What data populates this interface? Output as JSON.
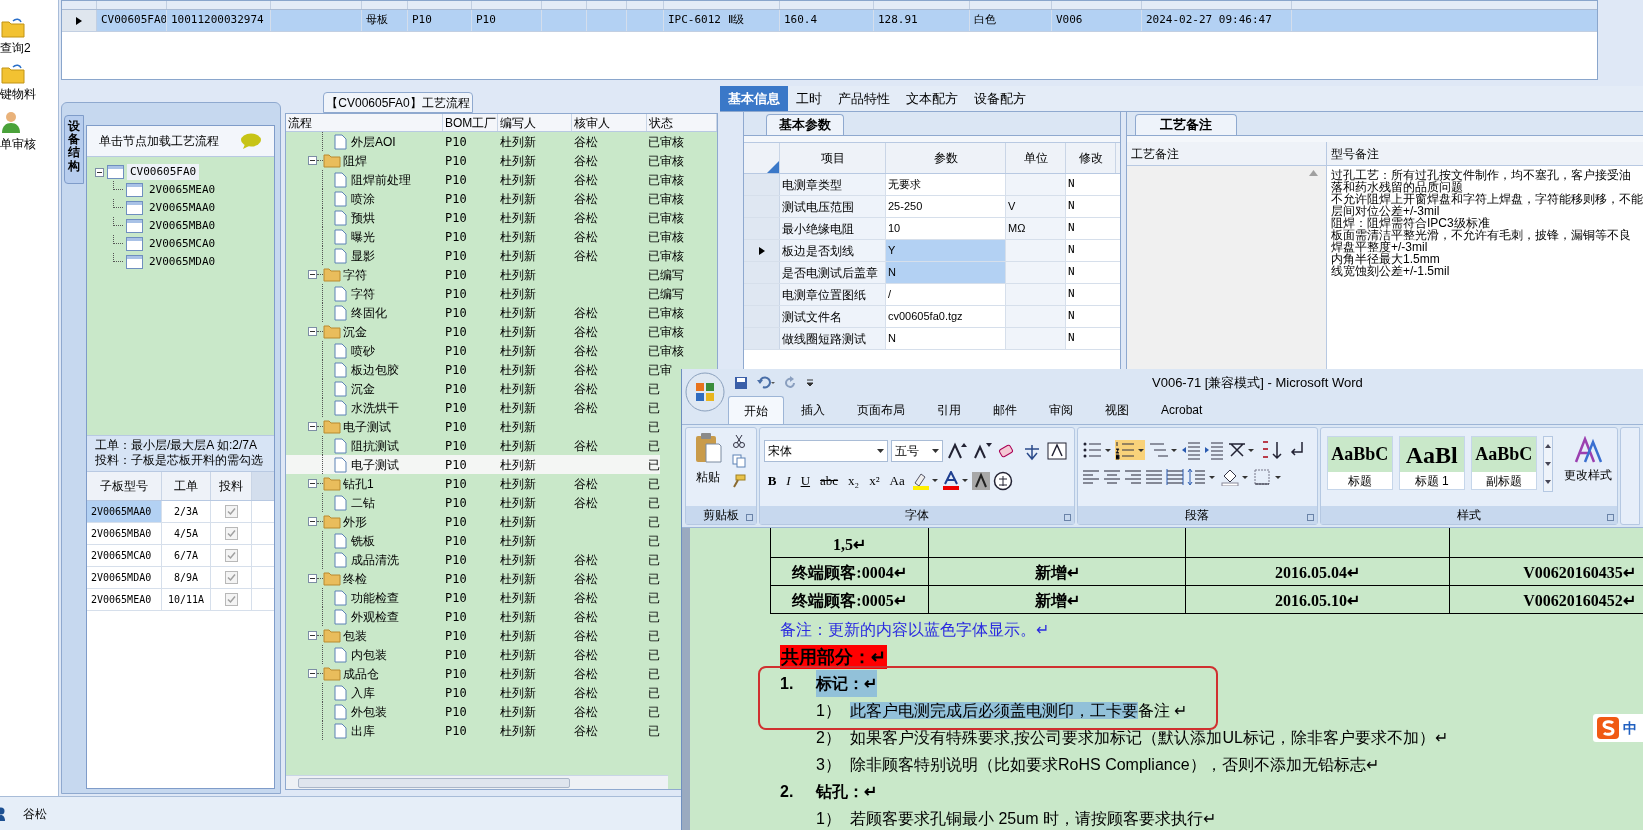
{
  "sidebar": {
    "items": [
      {
        "label": "查询2",
        "kind": "folder"
      },
      {
        "label": "键物料",
        "kind": "folder"
      },
      {
        "label": "单审核",
        "kind": "person"
      }
    ]
  },
  "top_grid": {
    "rows": [
      {
        "selected": true,
        "column_1": "CV00605FA0",
        "column_2": "10011200032974",
        "column_4": "母板",
        "column_5": "P10",
        "column_6": "P10",
        "column_10": "IPC-6012 Ⅱ级",
        "column_11": "160.4",
        "column_12": "128.91",
        "column_13": "白色",
        "column_14": "V006",
        "column_15": "2024-02-27 09:46:47"
      }
    ]
  },
  "structure_panel": {
    "tab": "设备结构",
    "hint": "单击节点加载工艺流程",
    "tree": {
      "label": "CV00605FA0",
      "expanded": true,
      "selected": true,
      "children": [
        {
          "label": "2V0065MEA0",
          "selected": false
        },
        {
          "label": "2V0065MAA0",
          "selected": false
        },
        {
          "label": "2V0065MBA0",
          "selected": false
        },
        {
          "label": "2V0065MCA0",
          "selected": false
        },
        {
          "label": "2V0065MDA0",
          "selected": false
        }
      ]
    },
    "notes": [
      "工单：最小层/最大层A 如:2/7A",
      "投料：子板是芯板开料的需勾选"
    ],
    "table": {
      "columns": [
        "子板型号",
        "工单",
        "投料"
      ],
      "rows": [
        {
          "model": "2V0065MAA0",
          "order": "2/3A",
          "feed": true,
          "selected": true
        },
        {
          "model": "2V0065MBA0",
          "order": "4/5A",
          "feed": true,
          "selected": false
        },
        {
          "model": "2V0065MCA0",
          "order": "6/7A",
          "feed": true,
          "selected": false
        },
        {
          "model": "2V0065MDA0",
          "order": "8/9A",
          "feed": true,
          "selected": false
        },
        {
          "model": "2V0065MEA0",
          "order": "10/11A",
          "feed": true,
          "selected": false
        }
      ]
    }
  },
  "flow_panel": {
    "title": "【CV00605FA0】工艺流程",
    "columns": [
      "流程",
      "BOM工厂",
      "编写人",
      "核审人",
      "状态"
    ],
    "items": [
      {
        "kind": "step",
        "label": "外层AOI",
        "bom": "P10",
        "writer": "杜列新",
        "reviewer": "谷松",
        "status": "已审核",
        "selected": false
      },
      {
        "kind": "group",
        "label": "阻焊",
        "bom": "P10",
        "writer": "杜列新",
        "reviewer": "谷松",
        "status": "已审核",
        "selected": false,
        "expanded": true,
        "children": [
          {
            "kind": "step",
            "label": "阻焊前处理",
            "bom": "P10",
            "writer": "杜列新",
            "reviewer": "谷松",
            "status": "已审核",
            "selected": false
          },
          {
            "kind": "step",
            "label": "喷涂",
            "bom": "P10",
            "writer": "杜列新",
            "reviewer": "谷松",
            "status": "已审核",
            "selected": false
          },
          {
            "kind": "step",
            "label": "预烘",
            "bom": "P10",
            "writer": "杜列新",
            "reviewer": "谷松",
            "status": "已审核",
            "selected": false
          },
          {
            "kind": "step",
            "label": "曝光",
            "bom": "P10",
            "writer": "杜列新",
            "reviewer": "谷松",
            "status": "已审核",
            "selected": false
          },
          {
            "kind": "step",
            "label": "显影",
            "bom": "P10",
            "writer": "杜列新",
            "reviewer": "谷松",
            "status": "已审核",
            "selected": false
          }
        ]
      },
      {
        "kind": "group",
        "label": "字符",
        "bom": "P10",
        "writer": "杜列新",
        "status": "已编写",
        "selected": false,
        "expanded": true,
        "children": [
          {
            "kind": "step",
            "label": "字符",
            "bom": "P10",
            "writer": "杜列新",
            "status": "已编写",
            "selected": false
          },
          {
            "kind": "step",
            "label": "终固化",
            "bom": "P10",
            "writer": "杜列新",
            "reviewer": "谷松",
            "status": "已审核",
            "selected": false
          }
        ]
      },
      {
        "kind": "group",
        "label": "沉金",
        "bom": "P10",
        "writer": "杜列新",
        "reviewer": "谷松",
        "status": "已审核",
        "selected": false,
        "expanded": true,
        "children": [
          {
            "kind": "step",
            "label": "喷砂",
            "bom": "P10",
            "writer": "杜列新",
            "reviewer": "谷松",
            "status": "已审核",
            "selected": false
          },
          {
            "kind": "step",
            "label": "板边包胶",
            "bom": "P10",
            "writer": "杜列新",
            "reviewer": "谷松",
            "status": "已审",
            "selected": false
          },
          {
            "kind": "step",
            "label": "沉金",
            "bom": "P10",
            "writer": "杜列新",
            "reviewer": "谷松",
            "status": "已",
            "selected": false
          },
          {
            "kind": "step",
            "label": "水洗烘干",
            "bom": "P10",
            "writer": "杜列新",
            "reviewer": "谷松",
            "status": "已",
            "selected": false
          }
        ]
      },
      {
        "kind": "group",
        "label": "电子测试",
        "bom": "P10",
        "writer": "杜列新",
        "status": "已",
        "selected": false,
        "expanded": true,
        "children": [
          {
            "kind": "step",
            "label": "阻抗测试",
            "bom": "P10",
            "writer": "杜列新",
            "reviewer": "谷松",
            "status": "已",
            "selected": false
          },
          {
            "kind": "step",
            "label": "电子测试",
            "bom": "P10",
            "writer": "杜列新",
            "status": "已",
            "selected": true
          }
        ]
      },
      {
        "kind": "group",
        "label": "钻孔1",
        "bom": "P10",
        "writer": "杜列新",
        "reviewer": "谷松",
        "status": "已",
        "selected": false,
        "expanded": true,
        "children": [
          {
            "kind": "step",
            "label": "二钻",
            "bom": "P10",
            "writer": "杜列新",
            "reviewer": "谷松",
            "status": "已",
            "selected": false
          }
        ]
      },
      {
        "kind": "group",
        "label": "外形",
        "bom": "P10",
        "writer": "杜列新",
        "status": "已",
        "selected": false,
        "expanded": true,
        "children": [
          {
            "kind": "step",
            "label": "铣板",
            "bom": "P10",
            "writer": "杜列新",
            "status": "已",
            "selected": false
          },
          {
            "kind": "step",
            "label": "成品清洗",
            "bom": "P10",
            "writer": "杜列新",
            "reviewer": "谷松",
            "status": "已",
            "selected": false
          }
        ]
      },
      {
        "kind": "group",
        "label": "终检",
        "bom": "P10",
        "writer": "杜列新",
        "reviewer": "谷松",
        "status": "已",
        "selected": false,
        "expanded": true,
        "children": [
          {
            "kind": "step",
            "label": "功能检查",
            "bom": "P10",
            "writer": "杜列新",
            "reviewer": "谷松",
            "status": "已",
            "selected": false
          },
          {
            "kind": "step",
            "label": "外观检查",
            "bom": "P10",
            "writer": "杜列新",
            "reviewer": "谷松",
            "status": "已",
            "selected": false
          }
        ]
      },
      {
        "kind": "group",
        "label": "包装",
        "bom": "P10",
        "writer": "杜列新",
        "reviewer": "谷松",
        "status": "已",
        "selected": false,
        "expanded": true,
        "children": [
          {
            "kind": "step",
            "label": "内包装",
            "bom": "P10",
            "writer": "杜列新",
            "reviewer": "谷松",
            "status": "已",
            "selected": false
          }
        ]
      },
      {
        "kind": "group",
        "label": "成品仓",
        "bom": "P10",
        "writer": "杜列新",
        "reviewer": "谷松",
        "status": "已",
        "selected": false,
        "expanded": true,
        "children": [
          {
            "kind": "step",
            "label": "入库",
            "bom": "P10",
            "writer": "杜列新",
            "reviewer": "谷松",
            "status": "已",
            "selected": false
          },
          {
            "kind": "step",
            "label": "外包装",
            "bom": "P10",
            "writer": "杜列新",
            "reviewer": "谷松",
            "status": "已",
            "selected": false
          },
          {
            "kind": "step",
            "label": "出库",
            "bom": "P10",
            "writer": "杜列新",
            "reviewer": "谷松",
            "status": "已",
            "selected": false
          }
        ]
      }
    ]
  },
  "detail_panel": {
    "tabs": [
      {
        "label": "基本信息",
        "selected": true
      },
      {
        "label": "工时",
        "selected": false
      },
      {
        "label": "产品特性",
        "selected": false
      },
      {
        "label": "文本配方",
        "selected": false
      },
      {
        "label": "设备配方",
        "selected": false
      }
    ],
    "params": {
      "tab": "基本参数",
      "columns": [
        "项目",
        "参数",
        "单位",
        "修改"
      ],
      "rows": [
        {
          "item": "电测章类型",
          "value": "无要求",
          "modified": "N",
          "selected": false,
          "current": false
        },
        {
          "item": "测试电压范围",
          "value": "25-250",
          "unit": "V",
          "modified": "N",
          "selected": false,
          "current": false
        },
        {
          "item": "最小绝缘电阻",
          "value": "10",
          "unit": "MΩ",
          "modified": "N",
          "selected": false,
          "current": false
        },
        {
          "item": "板边是否划线",
          "value": "Y",
          "modified": "N",
          "selected": true,
          "current": true
        },
        {
          "item": "是否电测试后盖章",
          "value": "N",
          "modified": "N",
          "selected": true,
          "current": false
        },
        {
          "item": "电测章位置图纸",
          "value": "/",
          "modified": "N",
          "selected": false,
          "current": false
        },
        {
          "item": "测试文件名",
          "value": "cv00605fa0.tgz",
          "modified": "N",
          "selected": false,
          "current": false
        },
        {
          "item": "做线圈短路测试",
          "value": "N",
          "modified": "N",
          "selected": false,
          "current": false
        }
      ]
    },
    "remarks": {
      "tab": "工艺备注",
      "columns": [
        "工艺备注",
        "型号备注"
      ],
      "model_remarks": [
        "过孔工艺：所有过孔按文件制作，均不塞孔，客户接受油",
        "落和药水残留的品质问题",
        "不允许阻焊上开窗焊盘和字符上焊盘，字符能移则移，不能",
        "层间对位公差+/-3mil",
        "阻焊：阻焊需符合IPC3级标准",
        "板面需清洁平整光滑，不允许有毛刺，披锋，漏铜等不良",
        "焊盘平整度+/-3mil",
        "内角半径最大1.5mm",
        "线宽蚀刻公差+/-1.5mil"
      ]
    }
  },
  "word_window": {
    "title": "V006-71 [兼容模式] - Microsoft Word",
    "tabs": [
      {
        "label": "开始",
        "selected": true
      },
      {
        "label": "插入",
        "selected": false
      },
      {
        "label": "页面布局",
        "selected": false
      },
      {
        "label": "引用",
        "selected": false
      },
      {
        "label": "邮件",
        "selected": false
      },
      {
        "label": "审阅",
        "selected": false
      },
      {
        "label": "视图",
        "selected": false
      },
      {
        "label": "Acrobat",
        "selected": false
      }
    ],
    "ribbon": {
      "paste": "粘贴",
      "font_name": "宋体",
      "font_size": "五号",
      "format_buttons": [
        "B",
        "I",
        "U",
        "abc",
        "x₂",
        "x²",
        "Aa"
      ],
      "numbering_on": true,
      "styles": [
        {
          "preview": "AaBbC",
          "label": "标题"
        },
        {
          "preview": "AaBl",
          "label": "标题 1"
        },
        {
          "preview": "AaBbC",
          "label": "副标题"
        }
      ],
      "change_styles": "更改样式",
      "groups": [
        "剪贴板",
        "字体",
        "段落",
        "样式"
      ]
    },
    "document": {
      "table_rows": [
        [
          "1,5↵"
        ],
        [
          "终端顾客:0004↵",
          "新增↵",
          "2016.05.04↵",
          "V00620160435↵"
        ],
        [
          "终端顾客:0005↵",
          "新增↵",
          "2016.05.10↵",
          "V00620160452↵"
        ]
      ],
      "note": "备注：更新的内容以蓝色字体显示。↵",
      "section_heading": "共用部分：↵",
      "items": [
        {
          "kind": "heading",
          "number": "1.",
          "text": "标记：↵",
          "highlighted": true
        },
        {
          "kind": "item",
          "number": "1）",
          "highlighted_text": "此客户电测完成后必须盖电测印，工卡要",
          "text": "备注 ↵"
        },
        {
          "kind": "item",
          "number": "2）",
          "text": "如果客户没有特殊要求,按公司要求加标记（默认添加UL标记，除非客户要求不加）↵"
        },
        {
          "kind": "item",
          "number": "3）",
          "text": "除非顾客特别说明（比如要求RoHS Compliance），否则不添加无铅标志↵"
        },
        {
          "kind": "heading",
          "number": "2.",
          "text": "钻孔：↵",
          "highlighted": false
        },
        {
          "kind": "item",
          "number": "1）",
          "text": "若顾客要求孔铜最小 25um 时，请按顾客要求执行↵"
        }
      ]
    },
    "ime_indicator": "中"
  },
  "status_bar": {
    "user": "谷松"
  }
}
